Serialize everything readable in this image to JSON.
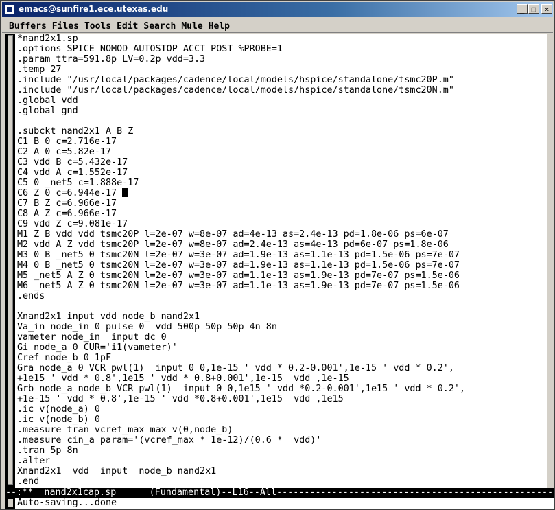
{
  "window": {
    "title": "emacs@sunfire1.ece.utexas.edu",
    "minimize_glyph": "_",
    "maximize_glyph": "□",
    "close_glyph": "×"
  },
  "menubar": {
    "items": [
      "Buffers",
      "Files",
      "Tools",
      "Edit",
      "Search",
      "Mule",
      "Help"
    ]
  },
  "buffer": {
    "cursor_line_index": 15,
    "cursor_column_text": "C6 Z 0 c=6.944e-17 ",
    "lines": [
      "*nand2x1.sp",
      ".options SPICE NOMOD AUTOSTOP ACCT POST %PROBE=1",
      ".param ttra=591.8p LV=0.2p vdd=3.3",
      ".temp 27",
      ".include \"/usr/local/packages/cadence/local/models/hspice/standalone/tsmc20P.m\"",
      ".include \"/usr/local/packages/cadence/local/models/hspice/standalone/tsmc20N.m\"",
      ".global vdd",
      ".global gnd",
      "",
      ".subckt nand2x1 A B Z",
      "C1 B 0 c=2.716e-17",
      "C2 A 0 c=5.82e-17",
      "C3 vdd B c=5.432e-17",
      "C4 vdd A c=1.552e-17",
      "C5 0 _net5 c=1.888e-17",
      "C6 Z 0 c=6.944e-17 ",
      "C7 B Z c=6.966e-17",
      "C8 A Z c=6.966e-17",
      "C9 vdd Z c=9.081e-17",
      "M1 Z B vdd vdd tsmc20P l=2e-07 w=8e-07 ad=4e-13 as=2.4e-13 pd=1.8e-06 ps=6e-07",
      "M2 vdd A Z vdd tsmc20P l=2e-07 w=8e-07 ad=2.4e-13 as=4e-13 pd=6e-07 ps=1.8e-06",
      "M3 0 B _net5 0 tsmc20N l=2e-07 w=3e-07 ad=1.9e-13 as=1.1e-13 pd=1.5e-06 ps=7e-07",
      "M4 0 B _net5 0 tsmc20N l=2e-07 w=3e-07 ad=1.9e-13 as=1.1e-13 pd=1.5e-06 ps=7e-07",
      "M5 _net5 A Z 0 tsmc20N l=2e-07 w=3e-07 ad=1.1e-13 as=1.9e-13 pd=7e-07 ps=1.5e-06",
      "M6 _net5 A Z 0 tsmc20N l=2e-07 w=3e-07 ad=1.1e-13 as=1.9e-13 pd=7e-07 ps=1.5e-06",
      ".ends",
      "",
      "Xnand2x1 input vdd node_b nand2x1",
      "Va_in node_in 0 pulse 0  vdd 500p 50p 50p 4n 8n",
      "vameter node_in  input dc 0",
      "Gi node_a 0 CUR='i1(vameter)'",
      "Cref node_b 0 1pF",
      "Gra node_a 0 VCR pwl(1)  input 0 0,1e-15 ' vdd * 0.2-0.001',1e-15 ' vdd * 0.2',",
      "+1e15 ' vdd * 0.8',1e15 ' vdd * 0.8+0.001',1e-15  vdd ,1e-15",
      "Grb node_a node_b VCR pwl(1)  input 0 0,1e15 ' vdd *0.2-0.001',1e15 ' vdd * 0.2',",
      "+1e-15 ' vdd * 0.8',1e-15 ' vdd *0.8+0.001',1e15  vdd ,1e15",
      ".ic v(node_a) 0",
      ".ic v(node_b) 0",
      ".measure tran vcref_max max v(0,node_b)",
      ".measure cin_a param='(vcref_max * 1e-12)/(0.6 *  vdd)'",
      ".tran 5p 8n",
      ".alter",
      "Xnand2x1  vdd  input  node_b nand2x1",
      ".end"
    ]
  },
  "modeline": {
    "text": "--:**  nand2x1cap.sp      (Fundamental)--L16--All---------------------------------------------------------"
  },
  "minibuffer": {
    "text": "Auto-saving...done"
  }
}
